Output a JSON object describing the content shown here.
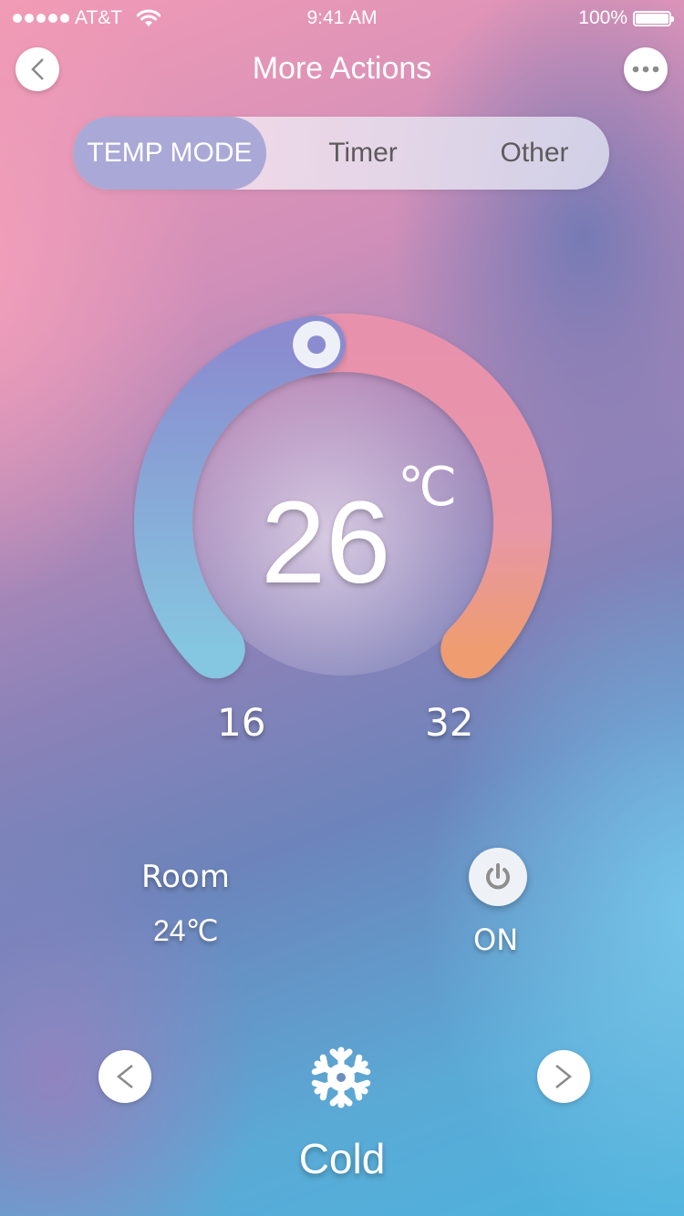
{
  "status_bar": {
    "carrier": "AT&T",
    "signal_bars": 5,
    "time": "9:41 AM",
    "battery_percent": "100%",
    "battery_level": 1.0
  },
  "header": {
    "title": "More Actions",
    "back_icon": "chevron-left-icon",
    "more_icon": "more-horizontal-icon"
  },
  "tabs": [
    {
      "label": "TEMP MODE",
      "active": true
    },
    {
      "label": "Timer",
      "active": false
    },
    {
      "label": "Other",
      "active": false
    }
  ],
  "thermostat": {
    "setpoint": 26,
    "setpoint_text": "26",
    "unit": "℃",
    "min": 16,
    "max": 32,
    "min_label": "16",
    "max_label": "32",
    "colors": {
      "cool_start": "#85c6e0",
      "cool_mid": "#8a8ccf",
      "warm": "#e891ad",
      "warm_end": "#ee9c70",
      "knob": "#eef0f7",
      "knob_dot": "#8a8ccf"
    }
  },
  "room": {
    "label": "Room",
    "temperature": "24℃"
  },
  "power": {
    "icon": "power-icon",
    "state_label": "ON"
  },
  "mode": {
    "prev_icon": "chevron-left-icon",
    "next_icon": "chevron-right-icon",
    "icon": "snowflake-icon",
    "label": "Cold"
  }
}
